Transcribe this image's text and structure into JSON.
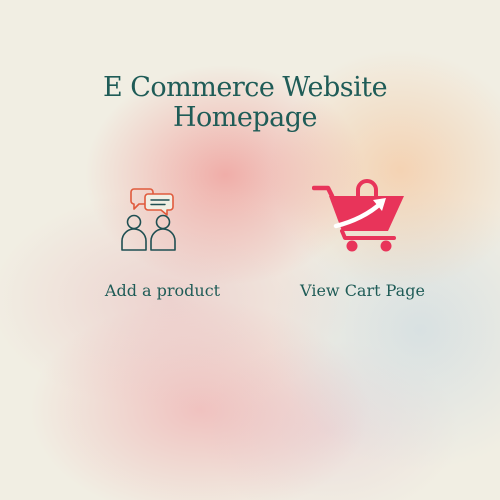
{
  "page": {
    "title_line1": "E Commerce Website",
    "title_line2": "Homepage"
  },
  "actions": {
    "add_product": {
      "label": "Add a product",
      "icon": "people-chat-icon"
    },
    "view_cart": {
      "label": "View Cart Page",
      "icon": "shopping-cart-icon"
    }
  },
  "colors": {
    "text": "#1f5c57",
    "cart_accent": "#e8345a",
    "icon_line": "#1f4f52",
    "chat_line": "#e05a3c",
    "background": "#f1eee3"
  }
}
